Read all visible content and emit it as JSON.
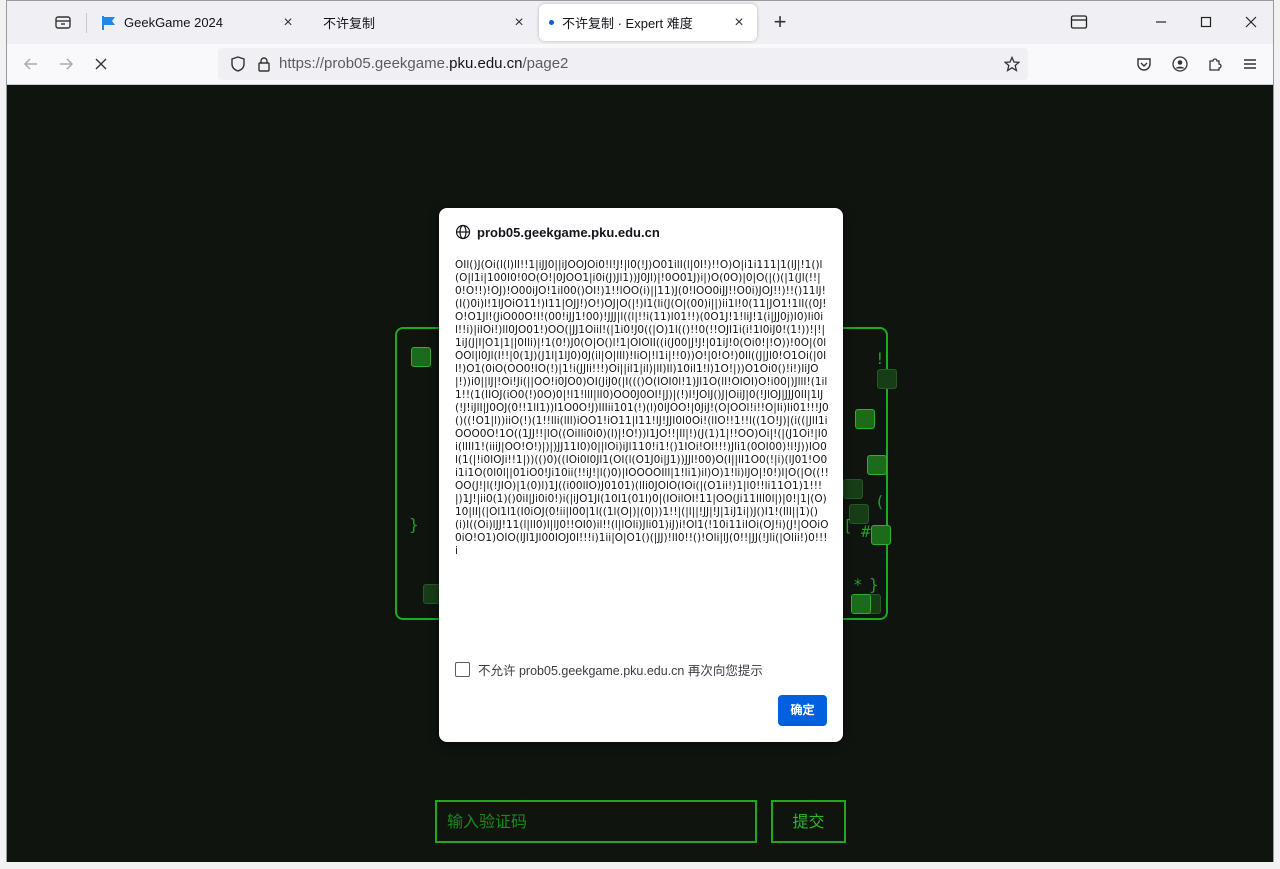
{
  "tabs": [
    {
      "label": "GeekGame 2024",
      "favicon": "flag-icon",
      "active": false
    },
    {
      "label": "不许复制",
      "active": false
    },
    {
      "label": "不许复制 · Expert 难度",
      "active": true
    }
  ],
  "address": {
    "prefix": "https://prob05.geekgame.",
    "host": "pku.edu.cn",
    "path": "/page2"
  },
  "dialog": {
    "origin": "prob05.geekgame.pku.edu.cn",
    "message": "OIl()J(Oi(l(l)lI!!1|iJJ0||iJOOJOi0!l!J!|l0(!J)O01ilI(l|0I!)!!O)O|i1i111|1(lJ|!1()l(O|l1i|100I0!0O(O!|0JOO1|i0i(J)Jl1))J0Jl)|!0O01J)i|)O(0O)|0|O(|()(|1(Jl(!!|0!O!!)!OJ)!O00iJO!1iI00()OI!)1!!lOO(i)||11)J(0!IOO0iJJ!!O0i)JOJ!!)!!()11lJ!(I()0i)l!1lJOiO11!)I11|OJJ!)O!)OJ|O(|!)I1(Ii(J(O|(00)i||)ii1l!0(11|JO1!1lI((0J!O!O1Jl!(JiO00O!I!(00!iJJ1!00)!JJJ|l((l|!!i(11)l01!!)(0O1J!1!liJ!1(i|JJ0j)I0)Ii0il!!i)|iIOi!)ll0JO01!)OO(|JJ1Oiil!(|1i0!J0((|O)1l(()!!0(!!OJI1i(i!1I0iJ0!(1!))!|!|1iJ(J|I|O1|1||0Ili)|!1(0!)J0(O|O()l!1|OIOII((i(J00|J!J!|01iJ!0(Oi0!|!O))!0O|(0lOOl|l0Jl(I!!|0(1J)(J1l|1lJ0)0J(il|O|lIl)!IiO|!l1i|!!0))O!|0!O!)0Il((J|Jl0!O1Oi(|0Il!)O1(0iO(OO0!IO(!)|1!i(JJli!!!)Oi||il1|il)|lI)Il)10iI1!l)1O!|))O1Oi0()!i!)IiJO|!))i0||lJ|!Oi!Ji(||OO!i0JO0)OI(JiJ0(|I((()O(IOI0l!1)Jl1O(lI!OlOI)O!i00|)JllI!(1il1!!(1(IIOJ(iO0(!)0O)0|!l1!llI|lI0)OO0J0OI!|J)|(!)I!JOlJ()J|OiiJ|0(!JlOJ|JJJ0II|1lJ(!J!iJlI|J0OJ(0!!1lI1))I1O0O!J)IIIii101(!)(l)0lJOO!|0JiJ!(O|OOl!i!!O|Ii)Ii01!!!J0()((!O1|l))iiO(!)(1!!lli(lIl)iOO1!iO11|I11!lJ!JJI0I0Oi!(lIO!!1!!l((1O!J)|(i((|JlI1iOOO0O!1O((1JJ!!|lO((OiIli0i0)(l)|!O!))l1JO!!|Il|!)(J(1)1|!!OO)Oi|!(|(J1Oi!|I0i(lIII1!(iiiJ|OO!O!)|)|)JJ11I0)0||lOi)iJl110!i1!()1IOi!OI!!!)Jli1(0OI00)!l!J))IO0l(1(|!i0IOJi!!1|))(()0)((IOi0I0Jl1(OI(l(O1J0i|J1))JJl!00)O(I||lI1O0(!|i)(lJ01!O0i1i1O(0l0l||01iO0!Ji10ii(!!iJ!|l()0)|IOOOOIll|1!li1)il)O)1!li)lJO|!0!)I|O(|O((!!OO(J!|l(!JIO)|1(0)l)1J((i00lIO)J0101)(lIi0JOlO(IOi(|(O1ii!)1|l0!!li11O1)1!!!|)1J!|ii0(1)()0iI|Ji0i0!)i(|iJO1JI(10I1(01l)0|(IOilOI!11|OO(Ji11lIl0l|)|0!|1|(O)10|lI|(|Ol1l1(I0iOJ(0!ii|I00|1l((1l(O|)|(0|))1!!|(|l||!JJ|!J|1iJ1i|)J()I1!(IlI||1)()(i)I((Oi)lJJ!11(l|lI0)I|lJ0!!OI0)il!!(l|lOli)Jli01)iJ)i!Ol1(!10i11iIOi(OJ!i)(J!|OOiO0iO!O1)OIO(lJl1Jl00IOJ0I!!!i)1ii|O|O1()(|JJ)!lI0!!()!Oli|lJ(0!!|JJ(!Jli(|Olii!)0!!!i",
    "checkbox_label": "不允许 prob05.geekgame.pku.edu.cn 再次向您提示",
    "ok_label": "确定"
  },
  "page": {
    "captcha_placeholder": "输入验证码",
    "submit_label": "提交"
  }
}
